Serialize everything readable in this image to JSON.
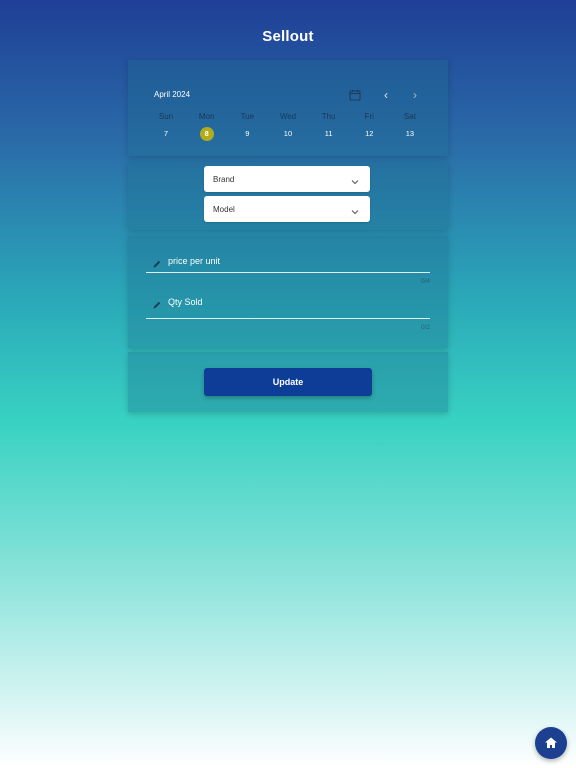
{
  "page": {
    "title": "Sellout"
  },
  "calendar": {
    "month_label": "April 2024",
    "icons": {
      "calendar": "calendar-icon",
      "prev": "chevron-left-icon",
      "next": "chevron-right-icon"
    },
    "prev_glyph": "‹",
    "next_glyph": "›",
    "days": [
      {
        "name": "Sun",
        "date": "7"
      },
      {
        "name": "Mon",
        "date": "8"
      },
      {
        "name": "Tue",
        "date": "9"
      },
      {
        "name": "Wed",
        "date": "10"
      },
      {
        "name": "Thu",
        "date": "11"
      },
      {
        "name": "Fri",
        "date": "12"
      },
      {
        "name": "Sat",
        "date": "13"
      }
    ],
    "selected_day": "Mon",
    "selected_color": "#b3ac1a"
  },
  "filters": {
    "brand": {
      "label": "Brand",
      "icon": "chevron-down-icon"
    },
    "model": {
      "label": "Model",
      "icon": "chevron-down-icon"
    }
  },
  "inputs": {
    "price": {
      "label": "price per unit",
      "counter": "0/4",
      "icon": "pencil-icon"
    },
    "qty": {
      "label": "Qty Sold",
      "counter": "0/2",
      "icon": "pencil-icon"
    }
  },
  "actions": {
    "update_label": "Update",
    "update_color": "#0d3d97"
  },
  "fab": {
    "icon": "home-icon",
    "color": "#1c3f8f"
  }
}
